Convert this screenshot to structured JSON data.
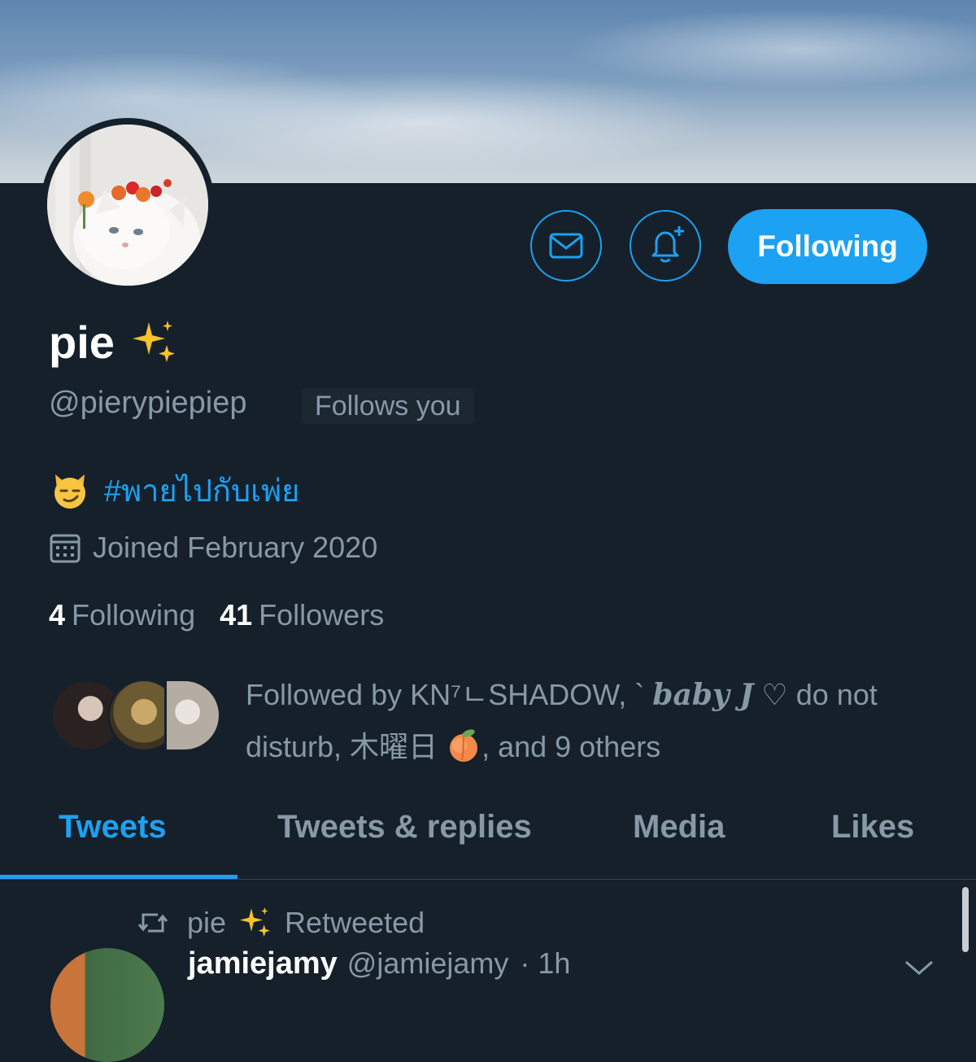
{
  "profile": {
    "display_name": "pie",
    "handle": "@pierypiepiep",
    "follows_you_badge": "Follows you",
    "bio_hashtag": "#พายไปกับเพ่ย",
    "joined": "Joined February 2020"
  },
  "actions": {
    "follow_button": "Following"
  },
  "stats": {
    "following_count": "4",
    "following_label": "Following",
    "followers_count": "41",
    "followers_label": "Followers"
  },
  "followed_by": {
    "prefix": "Followed by KN⁷ㄴSHADOW, ` ",
    "styled_name": "baby J",
    "middle": " ♡ do not disturb, 木曜日 ",
    "suffix": ", and 9 others"
  },
  "tabs": [
    "Tweets",
    "Tweets & replies",
    "Media",
    "Likes"
  ],
  "active_tab": "Tweets",
  "tweet": {
    "retweeted_by": "pie",
    "retweeted_label": "Retweeted",
    "author_name": "jamiejamy",
    "author_handle": "@jamiejamy",
    "time": "· 1h"
  },
  "colors": {
    "background": "#15202b",
    "accent": "#1da1f2",
    "secondary_text": "#8899a6"
  },
  "icons": [
    "mail-icon",
    "notification-bell-add-icon",
    "sparkles-emoji-icon",
    "smirking-cat-emoji-icon",
    "calendar-icon",
    "peach-emoji-icon",
    "retweet-icon",
    "chevron-down-icon"
  ]
}
